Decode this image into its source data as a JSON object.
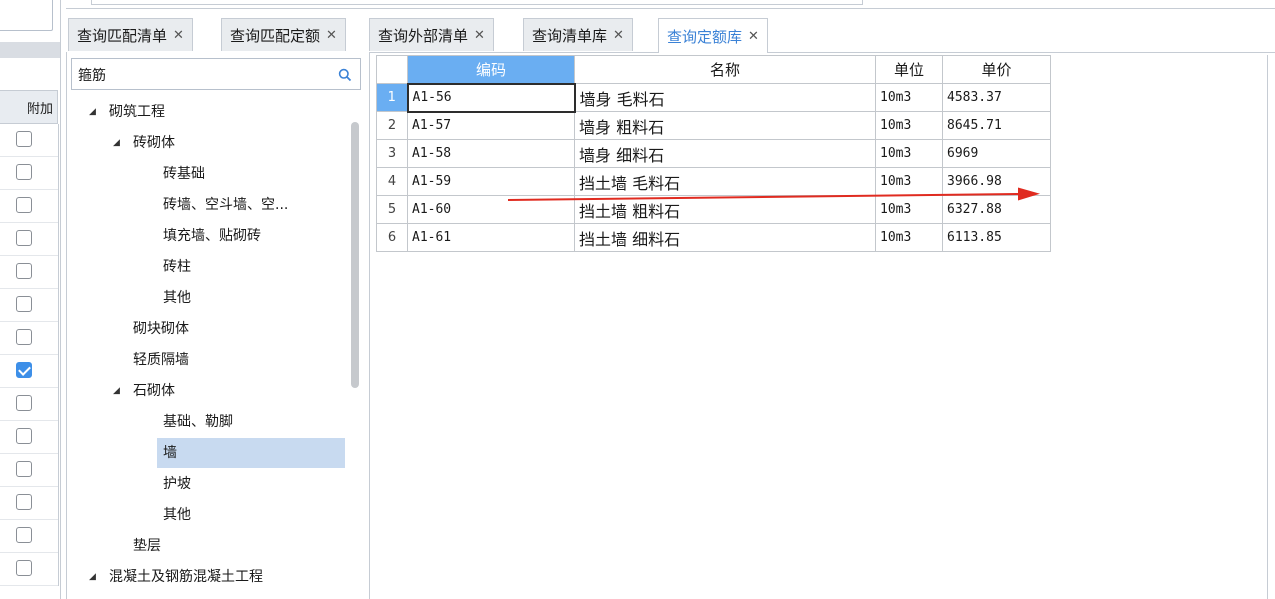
{
  "left_panel": {
    "column_header": "附加",
    "checkboxes": [
      false,
      false,
      false,
      false,
      false,
      false,
      false,
      true,
      false,
      false,
      false,
      false,
      false,
      false
    ]
  },
  "tabs": [
    {
      "label": "查询匹配清单",
      "close": "✕",
      "active": false
    },
    {
      "label": "查询匹配定额",
      "close": "✕",
      "active": false
    },
    {
      "label": "查询外部清单",
      "close": "✕",
      "active": false
    },
    {
      "label": "查询清单库",
      "close": "✕",
      "active": false
    },
    {
      "label": "查询定额库",
      "close": "✕",
      "active": true
    }
  ],
  "search": {
    "value": "箍筋",
    "icon": "search-icon"
  },
  "tree": [
    {
      "label": "砌筑工程",
      "level": 0,
      "expanded": true
    },
    {
      "label": "砖砌体",
      "level": 1,
      "expanded": true
    },
    {
      "label": "砖基础",
      "level": 2
    },
    {
      "label": "砖墙、空斗墙、空...",
      "level": 2
    },
    {
      "label": "填充墙、贴砌砖",
      "level": 2
    },
    {
      "label": "砖柱",
      "level": 2
    },
    {
      "label": "其他",
      "level": 2
    },
    {
      "label": "砌块砌体",
      "level": 1
    },
    {
      "label": "轻质隔墙",
      "level": 1
    },
    {
      "label": "石砌体",
      "level": 1,
      "expanded": true
    },
    {
      "label": "基础、勒脚",
      "level": 2
    },
    {
      "label": "墙",
      "level": 2,
      "selected": true
    },
    {
      "label": "护坡",
      "level": 2
    },
    {
      "label": "其他",
      "level": 2
    },
    {
      "label": "垫层",
      "level": 1
    },
    {
      "label": "混凝土及钢筋混凝土工程",
      "level": 0,
      "expanded": true
    }
  ],
  "grid": {
    "headers": {
      "code": "编码",
      "name": "名称",
      "unit": "单位",
      "price": "单价"
    },
    "rows": [
      {
        "n": "1",
        "code": "A1-56",
        "name": "墙身 毛料石",
        "unit": "10m3",
        "price": "4583.37"
      },
      {
        "n": "2",
        "code": "A1-57",
        "name": "墙身 粗料石",
        "unit": "10m3",
        "price": "8645.71"
      },
      {
        "n": "3",
        "code": "A1-58",
        "name": "墙身 细料石",
        "unit": "10m3",
        "price": "6969"
      },
      {
        "n": "4",
        "code": "A1-59",
        "name": "挡土墙 毛料石",
        "unit": "10m3",
        "price": "3966.98"
      },
      {
        "n": "5",
        "code": "A1-60",
        "name": "挡土墙 粗料石",
        "unit": "10m3",
        "price": "6327.88"
      },
      {
        "n": "6",
        "code": "A1-61",
        "name": "挡土墙 细料石",
        "unit": "10m3",
        "price": "6113.85"
      }
    ]
  },
  "colors": {
    "accent": "#3b82d6",
    "header_selected": "#6aaef2",
    "tree_selected": "#c8daf0",
    "annotation_arrow": "#e02b20"
  }
}
